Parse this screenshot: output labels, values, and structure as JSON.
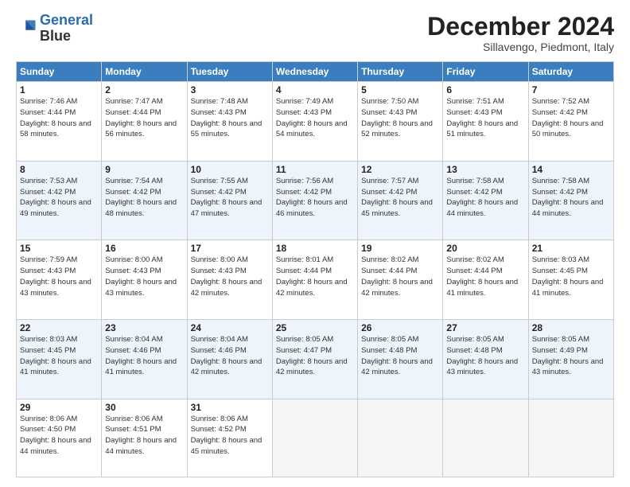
{
  "header": {
    "logo_line1": "General",
    "logo_line2": "Blue",
    "month": "December 2024",
    "location": "Sillavengo, Piedmont, Italy"
  },
  "days_of_week": [
    "Sunday",
    "Monday",
    "Tuesday",
    "Wednesday",
    "Thursday",
    "Friday",
    "Saturday"
  ],
  "weeks": [
    [
      {
        "day": "1",
        "sunrise": "7:46 AM",
        "sunset": "4:44 PM",
        "daylight": "8 hours and 58 minutes."
      },
      {
        "day": "2",
        "sunrise": "7:47 AM",
        "sunset": "4:44 PM",
        "daylight": "8 hours and 56 minutes."
      },
      {
        "day": "3",
        "sunrise": "7:48 AM",
        "sunset": "4:43 PM",
        "daylight": "8 hours and 55 minutes."
      },
      {
        "day": "4",
        "sunrise": "7:49 AM",
        "sunset": "4:43 PM",
        "daylight": "8 hours and 54 minutes."
      },
      {
        "day": "5",
        "sunrise": "7:50 AM",
        "sunset": "4:43 PM",
        "daylight": "8 hours and 52 minutes."
      },
      {
        "day": "6",
        "sunrise": "7:51 AM",
        "sunset": "4:43 PM",
        "daylight": "8 hours and 51 minutes."
      },
      {
        "day": "7",
        "sunrise": "7:52 AM",
        "sunset": "4:42 PM",
        "daylight": "8 hours and 50 minutes."
      }
    ],
    [
      {
        "day": "8",
        "sunrise": "7:53 AM",
        "sunset": "4:42 PM",
        "daylight": "8 hours and 49 minutes."
      },
      {
        "day": "9",
        "sunrise": "7:54 AM",
        "sunset": "4:42 PM",
        "daylight": "8 hours and 48 minutes."
      },
      {
        "day": "10",
        "sunrise": "7:55 AM",
        "sunset": "4:42 PM",
        "daylight": "8 hours and 47 minutes."
      },
      {
        "day": "11",
        "sunrise": "7:56 AM",
        "sunset": "4:42 PM",
        "daylight": "8 hours and 46 minutes."
      },
      {
        "day": "12",
        "sunrise": "7:57 AM",
        "sunset": "4:42 PM",
        "daylight": "8 hours and 45 minutes."
      },
      {
        "day": "13",
        "sunrise": "7:58 AM",
        "sunset": "4:42 PM",
        "daylight": "8 hours and 44 minutes."
      },
      {
        "day": "14",
        "sunrise": "7:58 AM",
        "sunset": "4:42 PM",
        "daylight": "8 hours and 44 minutes."
      }
    ],
    [
      {
        "day": "15",
        "sunrise": "7:59 AM",
        "sunset": "4:43 PM",
        "daylight": "8 hours and 43 minutes."
      },
      {
        "day": "16",
        "sunrise": "8:00 AM",
        "sunset": "4:43 PM",
        "daylight": "8 hours and 43 minutes."
      },
      {
        "day": "17",
        "sunrise": "8:00 AM",
        "sunset": "4:43 PM",
        "daylight": "8 hours and 42 minutes."
      },
      {
        "day": "18",
        "sunrise": "8:01 AM",
        "sunset": "4:44 PM",
        "daylight": "8 hours and 42 minutes."
      },
      {
        "day": "19",
        "sunrise": "8:02 AM",
        "sunset": "4:44 PM",
        "daylight": "8 hours and 42 minutes."
      },
      {
        "day": "20",
        "sunrise": "8:02 AM",
        "sunset": "4:44 PM",
        "daylight": "8 hours and 41 minutes."
      },
      {
        "day": "21",
        "sunrise": "8:03 AM",
        "sunset": "4:45 PM",
        "daylight": "8 hours and 41 minutes."
      }
    ],
    [
      {
        "day": "22",
        "sunrise": "8:03 AM",
        "sunset": "4:45 PM",
        "daylight": "8 hours and 41 minutes."
      },
      {
        "day": "23",
        "sunrise": "8:04 AM",
        "sunset": "4:46 PM",
        "daylight": "8 hours and 41 minutes."
      },
      {
        "day": "24",
        "sunrise": "8:04 AM",
        "sunset": "4:46 PM",
        "daylight": "8 hours and 42 minutes."
      },
      {
        "day": "25",
        "sunrise": "8:05 AM",
        "sunset": "4:47 PM",
        "daylight": "8 hours and 42 minutes."
      },
      {
        "day": "26",
        "sunrise": "8:05 AM",
        "sunset": "4:48 PM",
        "daylight": "8 hours and 42 minutes."
      },
      {
        "day": "27",
        "sunrise": "8:05 AM",
        "sunset": "4:48 PM",
        "daylight": "8 hours and 43 minutes."
      },
      {
        "day": "28",
        "sunrise": "8:05 AM",
        "sunset": "4:49 PM",
        "daylight": "8 hours and 43 minutes."
      }
    ],
    [
      {
        "day": "29",
        "sunrise": "8:06 AM",
        "sunset": "4:50 PM",
        "daylight": "8 hours and 44 minutes."
      },
      {
        "day": "30",
        "sunrise": "8:06 AM",
        "sunset": "4:51 PM",
        "daylight": "8 hours and 44 minutes."
      },
      {
        "day": "31",
        "sunrise": "8:06 AM",
        "sunset": "4:52 PM",
        "daylight": "8 hours and 45 minutes."
      },
      null,
      null,
      null,
      null
    ]
  ]
}
